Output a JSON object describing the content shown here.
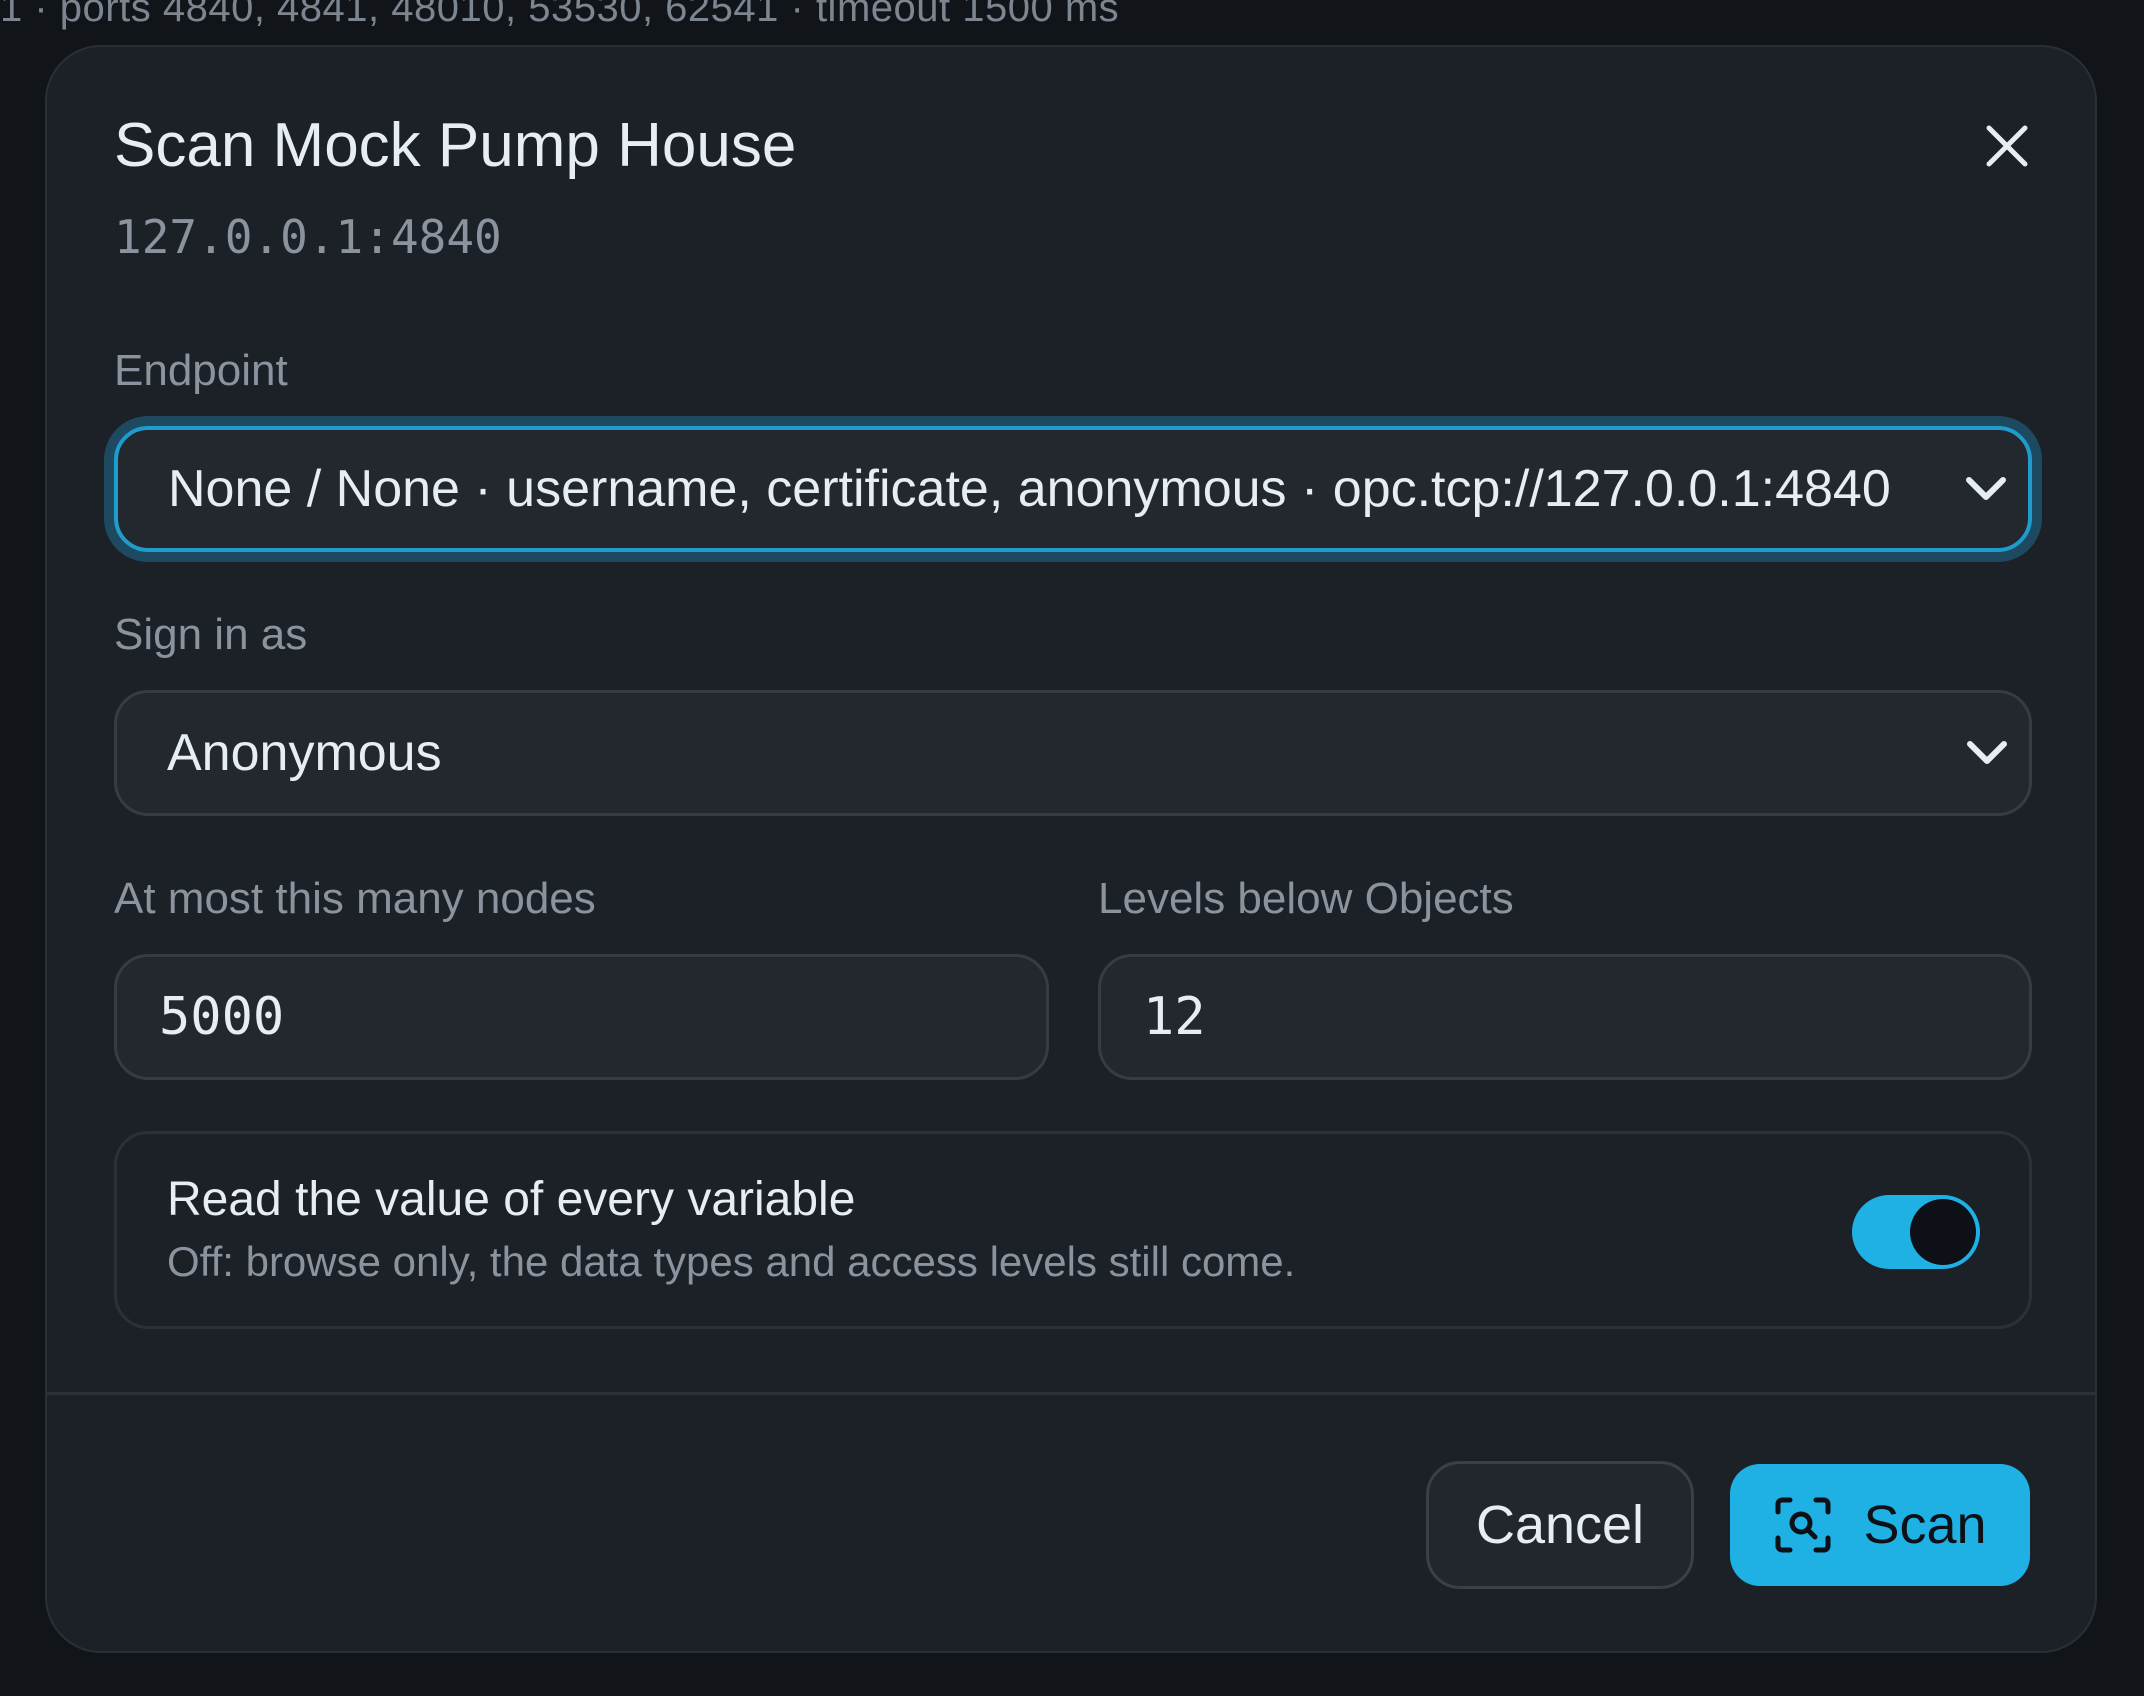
{
  "background": {
    "status_text": "1 · ports 4840, 4841, 48010, 53530, 62541 · timeout 1500 ms"
  },
  "dialog": {
    "title": "Scan Mock Pump House",
    "subtitle": "127.0.0.1:4840",
    "close_icon": "close-icon"
  },
  "endpoint": {
    "label": "Endpoint",
    "value": "None / None · username, certificate, anonymous · opc.tcp://127.0.0.1:4840"
  },
  "sign_in": {
    "label": "Sign in as",
    "value": "Anonymous"
  },
  "max_nodes": {
    "label": "At most this many nodes",
    "value": "5000"
  },
  "levels": {
    "label": "Levels below Objects",
    "value": "12"
  },
  "read_values": {
    "title": "Read the value of every variable",
    "description": "Off: browse only, the data types and access levels still come.",
    "enabled": true
  },
  "footer": {
    "cancel_label": "Cancel",
    "scan_label": "Scan",
    "scan_icon": "scan-search-icon"
  },
  "colors": {
    "accent": "#1fb1e3",
    "dialog_bg": "#1c2027",
    "page_bg": "#111419"
  }
}
